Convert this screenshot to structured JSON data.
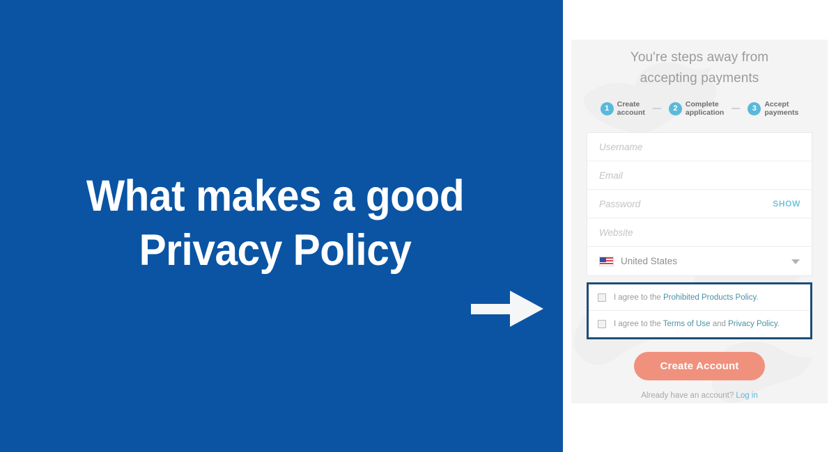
{
  "colors": {
    "panel_blue": "#0a54a3",
    "card_bg": "#f4f4f4",
    "accent_salmon": "#f0917d",
    "step_blue": "#59b9d9",
    "highlight_border": "#1c4d78",
    "link_blue": "#4a90a4"
  },
  "hero": {
    "headline_line1": "What makes a good",
    "headline_line2": "Privacy Policy",
    "arrow_icon": "arrow-right-icon"
  },
  "signup": {
    "title_line1": "You're steps away from",
    "title_line2": "accepting payments",
    "steps": [
      {
        "number": "1",
        "label_line1": "Create",
        "label_line2": "account"
      },
      {
        "number": "2",
        "label_line1": "Complete",
        "label_line2": "application"
      },
      {
        "number": "3",
        "label_line1": "Accept",
        "label_line2": "payments"
      }
    ],
    "fields": {
      "username_placeholder": "Username",
      "username_value": "",
      "email_placeholder": "Email",
      "email_value": "",
      "password_placeholder": "Password",
      "password_value": "",
      "show_label": "SHOW",
      "website_placeholder": "Website",
      "website_value": "",
      "country_value": "United States",
      "country_flag_icon": "us-flag-icon",
      "country_caret_icon": "chevron-down-icon"
    },
    "agreements": [
      {
        "prefix": "I agree to the ",
        "link1": "Prohibited Products Policy",
        "middle": "",
        "link2": "",
        "suffix": "."
      },
      {
        "prefix": "I agree to the ",
        "link1": "Terms of Use",
        "middle": " and ",
        "link2": "Privacy Policy",
        "suffix": "."
      }
    ],
    "submit_label": "Create Account",
    "login_prompt": "Already have an account?",
    "login_link": "Log in"
  }
}
